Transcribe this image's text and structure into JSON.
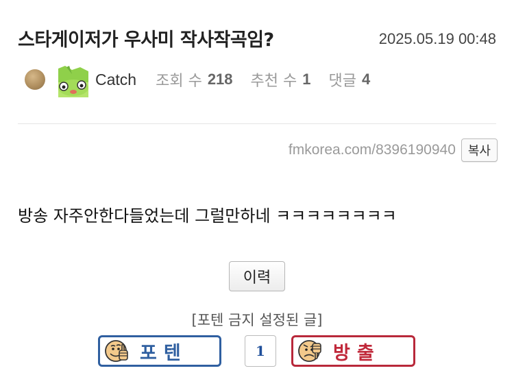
{
  "post": {
    "title": "스타게이저가 우사미 작사작곡임?",
    "datetime": "2025.05.19 00:48",
    "author": "Catch",
    "views_label": "조회 수",
    "views": "218",
    "recommends_label": "추천 수",
    "recommends": "1",
    "comments_label": "댓글",
    "comments": "4",
    "url": "fmkorea.com/8396190940",
    "copy_label": "복사",
    "body": "방송 자주안한다들었는데 그럴만하네 ㅋㅋㅋㅋㅋㅋㅋㅋ"
  },
  "actions": {
    "history_label": "이력",
    "notice": "[포텐 금지 설정된 글]",
    "upvote_label": "포텐",
    "vote_count": "1",
    "downvote_label": "방출"
  },
  "colors": {
    "upvote": "#2f5fa0",
    "downvote": "#b8283a"
  },
  "icons": {
    "level": "level-badge-icon",
    "avatar": "green-frog-avatar",
    "upvote": "thumbs-up-face-icon",
    "downvote": "thumbs-down-face-icon"
  }
}
